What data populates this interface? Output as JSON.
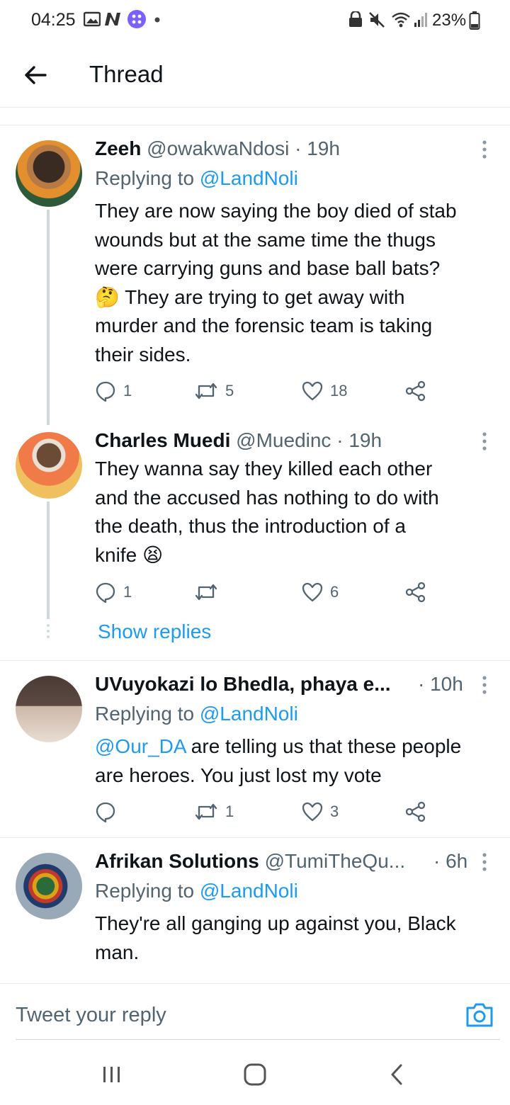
{
  "status_bar": {
    "time": "04:25",
    "battery": "23%",
    "icons": [
      "gallery-icon",
      "n-app-icon",
      "app-icon",
      "dot-icon",
      "lock-icon",
      "mute-icon",
      "wifi-icon",
      "signal-icon",
      "battery-icon"
    ]
  },
  "header": {
    "title": "Thread",
    "back_icon": "arrow-left-icon"
  },
  "tweets": [
    {
      "name": "Zeeh",
      "handle": "@owakwaNdosi",
      "dot": "·",
      "time": "19h",
      "replying_prefix": "Replying to ",
      "replying_to": "@LandNoli",
      "text_lines": [
        "They are now saying the boy died of stab",
        "wounds but at the same time the thugs",
        "were carrying guns and base ball bats?",
        "They are trying to get away with",
        "murder and the forensic team is  taking",
        "their sides."
      ],
      "emoji": "🤔",
      "replies": "1",
      "retweets": "5",
      "likes": "18"
    },
    {
      "name": "Charles Muedi",
      "handle": "@Muedinc",
      "dot": "·",
      "time": "19h",
      "text_lines": [
        "They wanna say they killed each other",
        "and the accused has nothing to do with",
        "the death, thus the introduction of a",
        "knife"
      ],
      "emoji": "😫",
      "replies": "1",
      "retweets": "",
      "likes": "6",
      "show_replies": "Show replies"
    },
    {
      "name": "UVuyokazi lo Bhedla, phaya e...",
      "dot": "·",
      "time": "10h",
      "replying_prefix": "Replying to ",
      "replying_to": "@LandNoli",
      "mention": "@Our_DA",
      "text_first_rest": " are telling us that these people",
      "text_line2": "are heroes.  You just lost my vote",
      "replies": "",
      "retweets": "1",
      "likes": "3"
    },
    {
      "name": "Afrikan Solutions",
      "handle": "@TumiTheQu...",
      "dot": "·",
      "time": "6h",
      "replying_prefix": "Replying to ",
      "replying_to": "@LandNoli",
      "text_lines": [
        "They're all ganging up against you, Black",
        "man."
      ]
    }
  ],
  "reply_bar": {
    "placeholder": "Tweet your reply",
    "camera_icon": "camera-icon"
  },
  "nav_bar": {
    "icons": [
      "recent-apps-icon",
      "home-icon",
      "back-icon"
    ]
  },
  "colors": {
    "link": "#1d9bf0",
    "secondary_text": "#536471",
    "divider": "#e6ecf0"
  }
}
